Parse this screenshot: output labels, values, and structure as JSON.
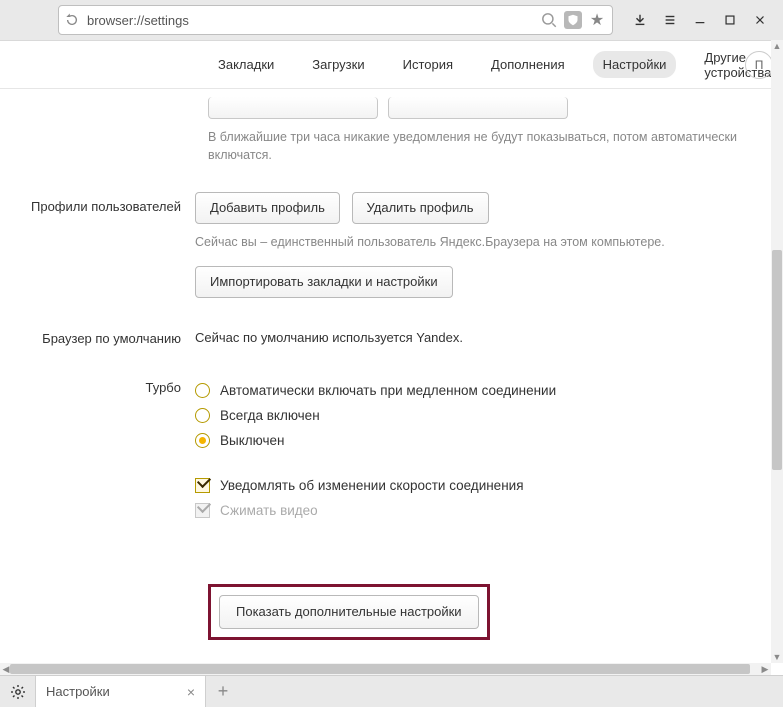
{
  "addressbar": {
    "url": "browser://settings"
  },
  "topnav": {
    "tabs": [
      "Закладки",
      "Загрузки",
      "История",
      "Дополнения",
      "Настройки",
      "Другие устройства"
    ],
    "active_index": 4,
    "search_hint": "П"
  },
  "notifications": {
    "note": "В ближайшие три часа никакие уведомления не будут показываться, потом автоматически включатся."
  },
  "profiles": {
    "section_label": "Профили пользователей",
    "add_btn": "Добавить профиль",
    "delete_btn": "Удалить профиль",
    "note": "Сейчас вы – единственный пользователь Яндекс.Браузера на этом компьютере.",
    "import_btn": "Импортировать закладки и настройки"
  },
  "default_browser": {
    "section_label": "Браузер по умолчанию",
    "text": "Сейчас по умолчанию используется Yandex."
  },
  "turbo": {
    "section_label": "Турбо",
    "options": [
      "Автоматически включать при медленном соединении",
      "Всегда включен",
      "Выключен"
    ],
    "selected_index": 2,
    "notify_label": "Уведомлять об изменении скорости соединения",
    "notify_checked": true,
    "compress_label": "Сжимать видео",
    "compress_checked": true,
    "compress_disabled": true
  },
  "show_more_btn": "Показать дополнительные настройки",
  "tabstrip": {
    "tab_title": "Настройки"
  }
}
